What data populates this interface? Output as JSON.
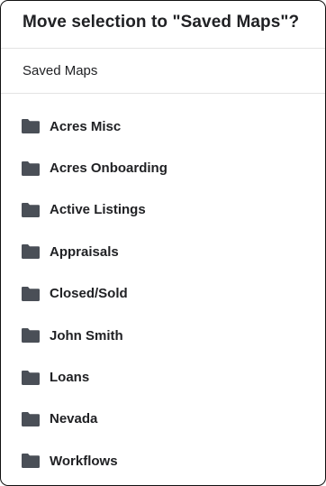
{
  "dialog": {
    "title": "Move selection to \"Saved Maps\"?",
    "breadcrumb": "Saved Maps"
  },
  "folders": [
    {
      "label": "Acres Misc",
      "icon": "folder-icon"
    },
    {
      "label": "Acres Onboarding",
      "icon": "folder-icon"
    },
    {
      "label": "Active Listings",
      "icon": "folder-icon"
    },
    {
      "label": "Appraisals",
      "icon": "folder-icon"
    },
    {
      "label": "Closed/Sold",
      "icon": "folder-icon"
    },
    {
      "label": "John Smith",
      "icon": "folder-icon"
    },
    {
      "label": "Loans",
      "icon": "folder-icon"
    },
    {
      "label": "Nevada",
      "icon": "folder-icon"
    },
    {
      "label": "Workflows",
      "icon": "folder-icon"
    }
  ],
  "colors": {
    "folder_icon": "#4a4f57",
    "text": "#202124",
    "divider": "#e3e3e3",
    "border": "#111111"
  }
}
